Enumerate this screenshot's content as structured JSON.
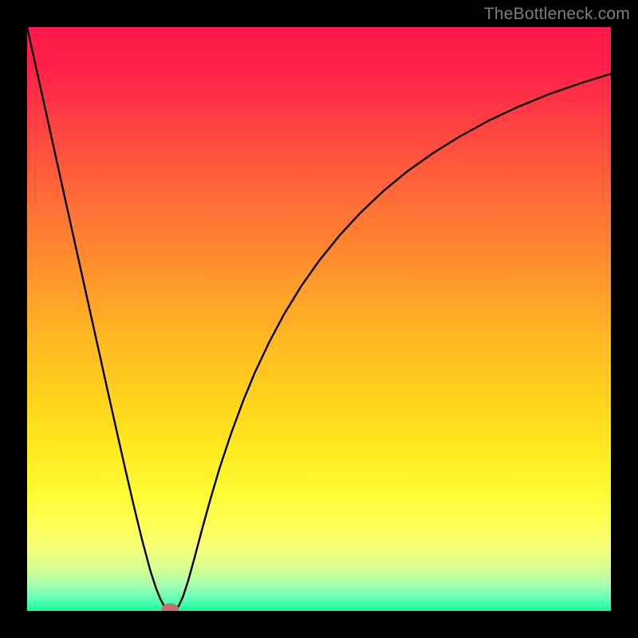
{
  "watermark": "TheBottleneck.com",
  "chart_data": {
    "type": "line",
    "title": "",
    "xlabel": "",
    "ylabel": "",
    "xlim": [
      0,
      100
    ],
    "ylim": [
      0,
      100
    ],
    "grid": false,
    "axes_hidden": true,
    "background": {
      "type": "vertical-gradient",
      "stops": [
        {
          "pos": 0.0,
          "color": "#ff1a4b"
        },
        {
          "pos": 0.06,
          "color": "#ff1e4a"
        },
        {
          "pos": 0.14,
          "color": "#ff3844"
        },
        {
          "pos": 0.24,
          "color": "#ff5a3c"
        },
        {
          "pos": 0.34,
          "color": "#ff7a33"
        },
        {
          "pos": 0.44,
          "color": "#ff9a2a"
        },
        {
          "pos": 0.54,
          "color": "#ffba22"
        },
        {
          "pos": 0.64,
          "color": "#ffd31c"
        },
        {
          "pos": 0.72,
          "color": "#ffe91f"
        },
        {
          "pos": 0.8,
          "color": "#fffb33"
        },
        {
          "pos": 0.85,
          "color": "#ffff55"
        },
        {
          "pos": 0.895,
          "color": "#f5ff78"
        },
        {
          "pos": 0.925,
          "color": "#d8ff90"
        },
        {
          "pos": 0.955,
          "color": "#a7ffac"
        },
        {
          "pos": 0.975,
          "color": "#6fffb6"
        },
        {
          "pos": 0.99,
          "color": "#35ffaa"
        },
        {
          "pos": 1.0,
          "color": "#1aff93"
        }
      ]
    },
    "series": [
      {
        "name": "bottleneck-curve",
        "color": "#000000",
        "width": 2.4,
        "x": [
          0.0,
          1.41,
          2.82,
          4.23,
          5.63,
          7.04,
          8.45,
          9.86,
          11.27,
          12.68,
          14.08,
          15.49,
          16.9,
          18.31,
          19.72,
          21.13,
          22.1,
          22.8,
          23.41,
          24.1,
          24.91,
          25.4,
          26.0,
          26.7,
          27.6,
          28.8,
          30.0,
          31.5,
          33.0,
          35.0,
          37.0,
          39.0,
          41.5,
          44.0,
          47.0,
          50.0,
          53.5,
          57.0,
          61.0,
          65.0,
          69.5,
          74.0,
          79.0,
          84.0,
          89.5,
          95.0,
          100.0
        ],
        "y": [
          100.0,
          93.64,
          87.27,
          80.9,
          74.54,
          68.18,
          61.82,
          55.46,
          49.1,
          42.76,
          36.43,
          30.14,
          23.92,
          17.85,
          12.06,
          6.82,
          3.85,
          2.1,
          0.95,
          0.26,
          0.0,
          0.14,
          0.9,
          2.45,
          5.2,
          9.55,
          14.1,
          19.5,
          24.55,
          30.55,
          35.95,
          40.8,
          46.1,
          50.8,
          55.7,
          59.95,
          64.3,
          68.1,
          71.9,
          75.2,
          78.4,
          81.2,
          83.95,
          86.3,
          88.55,
          90.45,
          92.0
        ]
      }
    ],
    "marker": {
      "x": 24.5,
      "y": 0.25,
      "rx": 1.5,
      "ry": 1.05,
      "color": "#c96d6d"
    }
  }
}
